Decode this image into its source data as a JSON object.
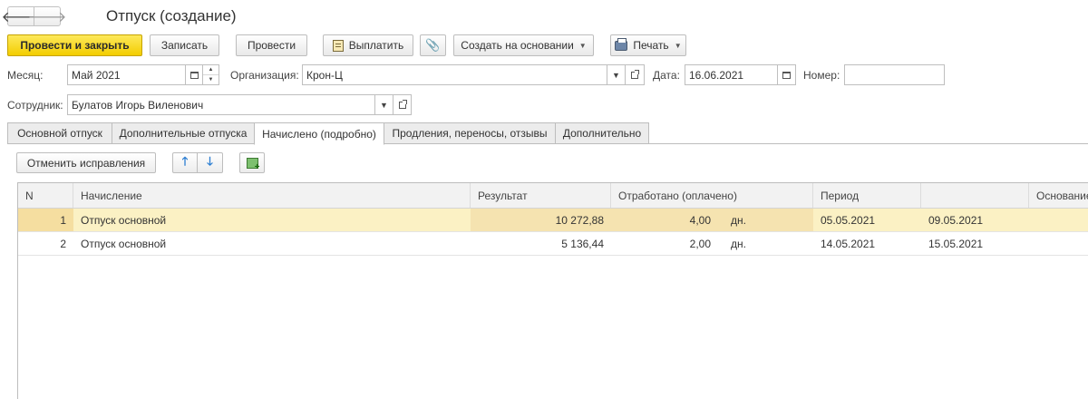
{
  "header": {
    "title": "Отпуск (создание)",
    "back_glyph": "🡐",
    "forward_glyph": "🡒"
  },
  "toolbar": {
    "post_close": "Провести и закрыть",
    "save": "Записать",
    "post": "Провести",
    "pay": "Выплатить",
    "create_based": "Создать на основании",
    "print": "Печать"
  },
  "form": {
    "month_label": "Месяц:",
    "month_value": "Май 2021",
    "org_label": "Организация:",
    "org_value": "Крон-Ц",
    "date_label": "Дата:",
    "date_value": "16.06.2021",
    "number_label": "Номер:",
    "number_value": "",
    "employee_label": "Сотрудник:",
    "employee_value": "Булатов Игорь Виленович"
  },
  "tabs": [
    {
      "label": "Основной отпуск",
      "active": false
    },
    {
      "label": "Дополнительные отпуска",
      "active": false
    },
    {
      "label": "Начислено (подробно)",
      "active": true
    },
    {
      "label": "Продления, переносы, отзывы",
      "active": false
    },
    {
      "label": "Дополнительно",
      "active": false
    }
  ],
  "table_toolbar": {
    "cancel_corrections": "Отменить исправления"
  },
  "table": {
    "columns": [
      "N",
      "Начисление",
      "Результат",
      "Отработано (оплачено)",
      "Период",
      "",
      "Основание"
    ],
    "rows": [
      {
        "n": "1",
        "accrual": "Отпуск основной",
        "result": "10 272,88",
        "worked": "4,00",
        "unit": "дн.",
        "from": "05.05.2021",
        "to": "09.05.2021",
        "basis": ""
      },
      {
        "n": "2",
        "accrual": "Отпуск основной",
        "result": "5 136,44",
        "worked": "2,00",
        "unit": "дн.",
        "from": "14.05.2021",
        "to": "15.05.2021",
        "basis": ""
      }
    ]
  },
  "colors": {
    "primary_button": "#f3cd00",
    "selected_row": "#fbf1c4",
    "arrow_blue": "#2e7fd2"
  }
}
